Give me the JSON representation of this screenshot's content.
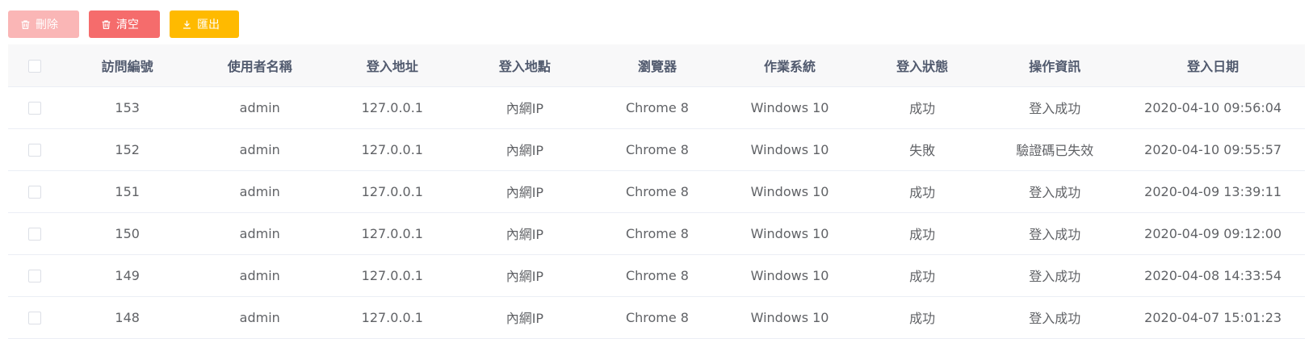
{
  "toolbar": {
    "delete_label": "刪除",
    "clear_label": "清空",
    "export_label": "匯出",
    "delete_icon": "trash-icon",
    "clear_icon": "trash-icon",
    "export_icon": "download-icon",
    "delete_color": "#fab6b6",
    "clear_color": "#f56c6c",
    "export_color": "#ffba00"
  },
  "table": {
    "columns": [
      "訪問編號",
      "使用者名稱",
      "登入地址",
      "登入地點",
      "瀏覽器",
      "作業系統",
      "登入狀態",
      "操作資訊",
      "登入日期"
    ],
    "rows": [
      [
        "153",
        "admin",
        "127.0.0.1",
        "內網IP",
        "Chrome 8",
        "Windows 10",
        "成功",
        "登入成功",
        "2020-04-10 09:56:04"
      ],
      [
        "152",
        "admin",
        "127.0.0.1",
        "內網IP",
        "Chrome 8",
        "Windows 10",
        "失敗",
        "驗證碼已失效",
        "2020-04-10 09:55:57"
      ],
      [
        "151",
        "admin",
        "127.0.0.1",
        "內網IP",
        "Chrome 8",
        "Windows 10",
        "成功",
        "登入成功",
        "2020-04-09 13:39:11"
      ],
      [
        "150",
        "admin",
        "127.0.0.1",
        "內網IP",
        "Chrome 8",
        "Windows 10",
        "成功",
        "登入成功",
        "2020-04-09 09:12:00"
      ],
      [
        "149",
        "admin",
        "127.0.0.1",
        "內網IP",
        "Chrome 8",
        "Windows 10",
        "成功",
        "登入成功",
        "2020-04-08 14:33:54"
      ],
      [
        "148",
        "admin",
        "127.0.0.1",
        "內網IP",
        "Chrome 8",
        "Windows 10",
        "成功",
        "登入成功",
        "2020-04-07 15:01:23"
      ]
    ]
  }
}
